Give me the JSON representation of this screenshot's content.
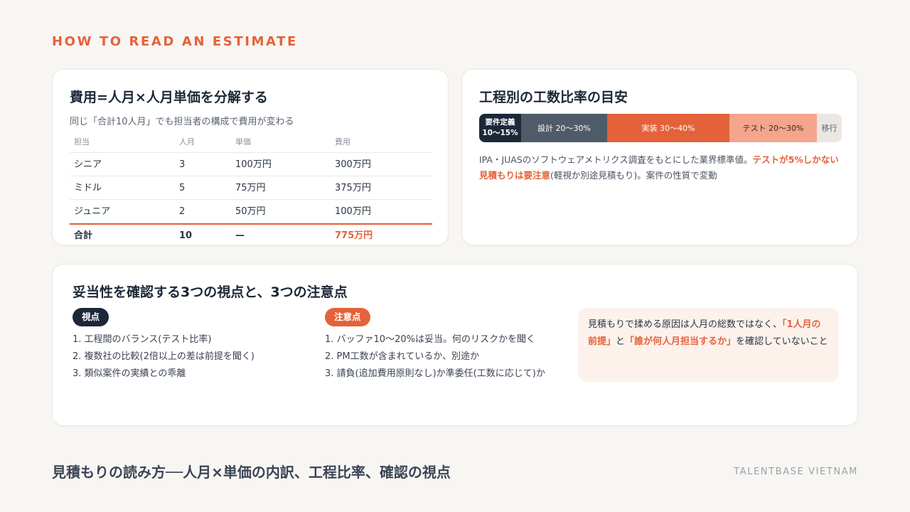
{
  "eyebrow": "HOW TO READ AN ESTIMATE",
  "cost_card": {
    "title": "費用=人月×人月単価を分解する",
    "subtitle": "同じ「合計10人月」でも担当者の構成で費用が変わる",
    "headers": [
      "担当",
      "人月",
      "単価",
      "費用"
    ],
    "rows": [
      [
        "シニア",
        "3",
        "100万円",
        "300万円"
      ],
      [
        "ミドル",
        "5",
        "75万円",
        "375万円"
      ],
      [
        "ジュニア",
        "2",
        "50万円",
        "100万円"
      ]
    ],
    "total": [
      "合計",
      "10",
      "—",
      "775万円"
    ]
  },
  "ratio_card": {
    "title": "工程別の工数比率の目安",
    "segments": [
      {
        "label_line1": "要件定義",
        "label_line2": "10〜15%",
        "share": 12.5
      },
      {
        "label": "設計 20〜30%",
        "share": 25
      },
      {
        "label": "実装 30〜40%",
        "share": 35
      },
      {
        "label": "テスト 20〜30%",
        "share": 25
      },
      {
        "label": "移行",
        "share": 7
      }
    ],
    "note_plain1": "IPA・JUASのソフトウェアメトリクス調査をもとにした業界標準値。",
    "note_emphasis": "テストが5%しかない見積もりは要注意",
    "note_plain2": "(軽視か別途見積もり)。案件の性質で変動"
  },
  "check_card": {
    "title": "妥当性を確認する3つの視点と、3つの注意点",
    "viewpoints_label": "視点",
    "viewpoints": [
      "1. 工程間のバランス(テスト比率)",
      "2. 複数社の比較(2倍以上の差は前提を聞く)",
      "3. 類似案件の実績との乖離"
    ],
    "cautions_label": "注意点",
    "cautions": [
      "1. バッファ10〜20%は妥当。何のリスクかを聞く",
      "2. PM工数が含まれているか、別途か",
      "3. 請負(追加費用原則なし)か準委任(工数に応じて)か"
    ],
    "callout_plain1": "見積もりで揉める原因は人月の総数ではなく、",
    "callout_em1": "「1人月の前提」",
    "callout_plain2": "と",
    "callout_em2": "「誰が何人月担当するか」",
    "callout_plain3": "を確認していないこと"
  },
  "footer": {
    "title": "見積もりの読み方──人月×単価の内訳、工程比率、確認の視点",
    "brand": "TALENTBASE VIETNAM"
  },
  "colors": {
    "accent": "#e4623a",
    "navy": "#1c2838",
    "slate": "#4f5b69",
    "peach": "#f4a58c",
    "sand": "#ebe7e2"
  }
}
